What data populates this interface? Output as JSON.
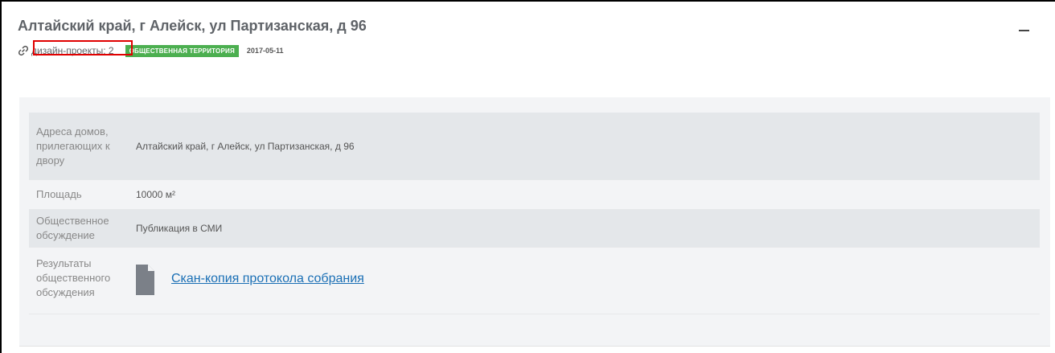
{
  "card": {
    "title": "Алтайский край, г Алейск, ул Партизанская, д 96",
    "design_projects_link": "дизайн-проекты: 2",
    "badge": "ОБЩЕСТВЕННАЯ ТЕРРИТОРИЯ",
    "badge_color": "#4caf50",
    "date": "2017-05-11",
    "collapse_icon": "minus-icon"
  },
  "details": {
    "rows": [
      {
        "label": "Адреса домов, прилегающих к двору",
        "value": "Алтайский край, г Алейск, ул Партизанская, д 96"
      },
      {
        "label": "Площадь",
        "value": "10000 м²"
      },
      {
        "label": "Общественное обсуждение",
        "value": "Публикация в СМИ"
      },
      {
        "label": "Результаты общественного обсуждения",
        "file_icon": "document-icon",
        "file_link": "Скан-копия протокола собрания"
      }
    ]
  },
  "colors": {
    "link": "#1a6fb5",
    "highlight": "#e00000",
    "panel_bg": "#f3f4f6",
    "row_shade": "#e4e7ea"
  }
}
